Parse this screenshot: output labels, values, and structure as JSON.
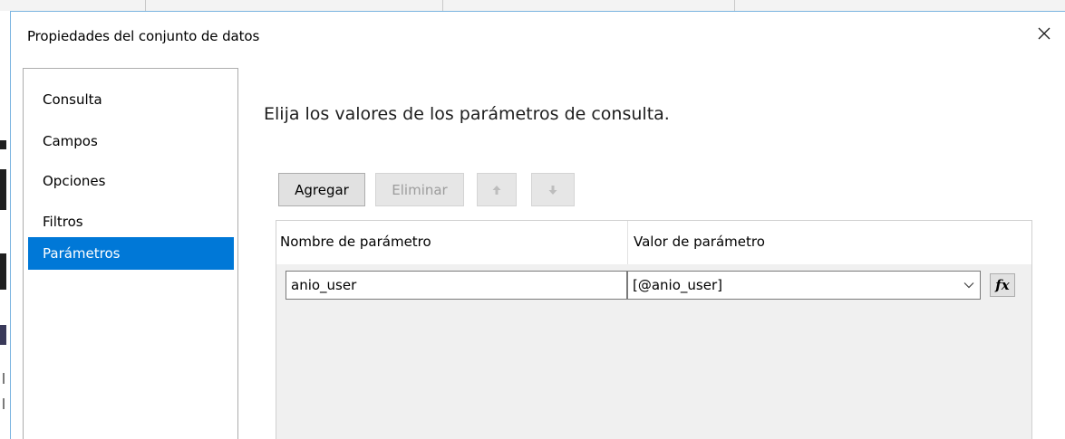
{
  "dialog": {
    "title": "Propiedades del conjunto de datos",
    "close_glyph": "×"
  },
  "nav": {
    "items": [
      {
        "label": "Consulta",
        "selected": false
      },
      {
        "label": "Campos",
        "selected": false
      },
      {
        "label": "Opciones",
        "selected": false
      },
      {
        "label": "Filtros",
        "selected": false
      },
      {
        "label": "Parámetros",
        "selected": true
      }
    ]
  },
  "main": {
    "heading": "Elija los valores de los parámetros de consulta.",
    "toolbar": {
      "add_label": "Agregar",
      "delete_label": "Eliminar",
      "move_up_icon": "arrow-up-icon",
      "move_down_icon": "arrow-down-icon"
    },
    "grid": {
      "columns": [
        "Nombre de parámetro",
        "Valor de parámetro"
      ],
      "rows": [
        {
          "name": "anio_user",
          "value": "[@anio_user]"
        }
      ],
      "expression_button": "fx"
    }
  },
  "colors": {
    "accent": "#0078d7",
    "dialog_border": "#7ab4e0"
  }
}
